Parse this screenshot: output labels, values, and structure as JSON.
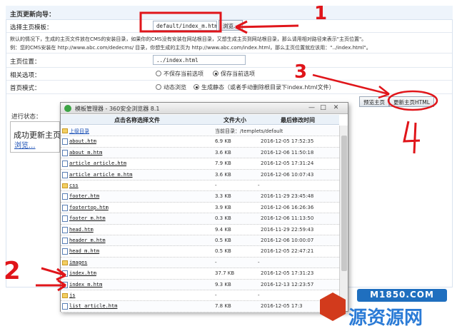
{
  "header": {
    "title": "主页更新向导："
  },
  "template_row": {
    "label": "选择主页模板：",
    "value": "default/index_m.htm",
    "browse": "浏览..."
  },
  "description": {
    "line1": "默认的情况下，生成的主页文件放在CMS的安装目录，如果你的CMS没有安装在网站根目录，又想生成主页到网站根目录，那么请用相对路径来表示\"主页位置\"。",
    "line2": "例：您的CMS安装在 http://www.abc.com/dedecms/ 目录，你想生成的主页为 http://www.abc.com/index.html，那么主页位置就应该用：\"../index.html\"。"
  },
  "location_row": {
    "label": "主页位置：",
    "value": "../index.html"
  },
  "options_row": {
    "label": "相关选项：",
    "opt1": "不保存当前选项",
    "opt2": "保存当前选项"
  },
  "mode_row": {
    "label": "首页模式：",
    "opt1": "动态浏览",
    "opt2": "生成静态（或者手动删除根目录下index.html文件）"
  },
  "actions": {
    "preview": "预览主页",
    "update": "更新主页HTML"
  },
  "progress": {
    "label": "进行状态：",
    "status": "成功更新主页",
    "link": "浏览..."
  },
  "template_window": {
    "title": "模板管理器 - 360安全浏览器 8.1",
    "columns": [
      "点击名称选择文件",
      "文件大小",
      "最后修改时间"
    ],
    "parent": {
      "name": "上级目录",
      "current": "当前目录：/templets/default"
    },
    "files": [
      {
        "name": "about.htm",
        "size": "6.9 KB",
        "date": "2016-12-05 17:52:35",
        "type": "file"
      },
      {
        "name": "about_m.htm",
        "size": "3.6 KB",
        "date": "2016-12-06 11:50:18",
        "type": "file"
      },
      {
        "name": "article_article.htm",
        "size": "7.9 KB",
        "date": "2016-12-05 17:31:24",
        "type": "file"
      },
      {
        "name": "article_article_m.htm",
        "size": "3.6 KB",
        "date": "2016-12-06 10:07:43",
        "type": "file"
      },
      {
        "name": "css",
        "size": "-",
        "date": "-",
        "type": "folder"
      },
      {
        "name": "footer.htm",
        "size": "3.3 KB",
        "date": "2016-11-29 23:45:48",
        "type": "file"
      },
      {
        "name": "footertop.htm",
        "size": "3.9 KB",
        "date": "2016-12-06 16:26:36",
        "type": "file"
      },
      {
        "name": "footer_m.htm",
        "size": "0.3 KB",
        "date": "2016-12-06 11:13:50",
        "type": "file"
      },
      {
        "name": "head.htm",
        "size": "9.4 KB",
        "date": "2016-11-29 22:59:43",
        "type": "file"
      },
      {
        "name": "header_m.htm",
        "size": "0.5 KB",
        "date": "2016-12-06 10:00:07",
        "type": "file"
      },
      {
        "name": "head_m.htm",
        "size": "0.5 KB",
        "date": "2016-12-05 22:47:21",
        "type": "file"
      },
      {
        "name": "images",
        "size": "-",
        "date": "-",
        "type": "folder"
      },
      {
        "name": "index.htm",
        "size": "37.7 KB",
        "date": "2016-12-05 17:31:23",
        "type": "file"
      },
      {
        "name": "index_m.htm",
        "size": "9.3 KB",
        "date": "2016-12-13 12:23:57",
        "type": "file"
      },
      {
        "name": "js",
        "size": "-",
        "date": "-",
        "type": "folder"
      },
      {
        "name": "list_article.htm",
        "size": "7.8 KB",
        "date": "2016-12-05 17:3",
        "type": "file"
      }
    ]
  },
  "annotations": {
    "n1": "1",
    "n2": "2",
    "n3": "3",
    "n4": "4"
  },
  "watermark": {
    "site": "M1850.COM",
    "brand": "源资源网"
  },
  "colors": {
    "annotation": "#e0151a",
    "header_bg": "#eef4fb"
  }
}
